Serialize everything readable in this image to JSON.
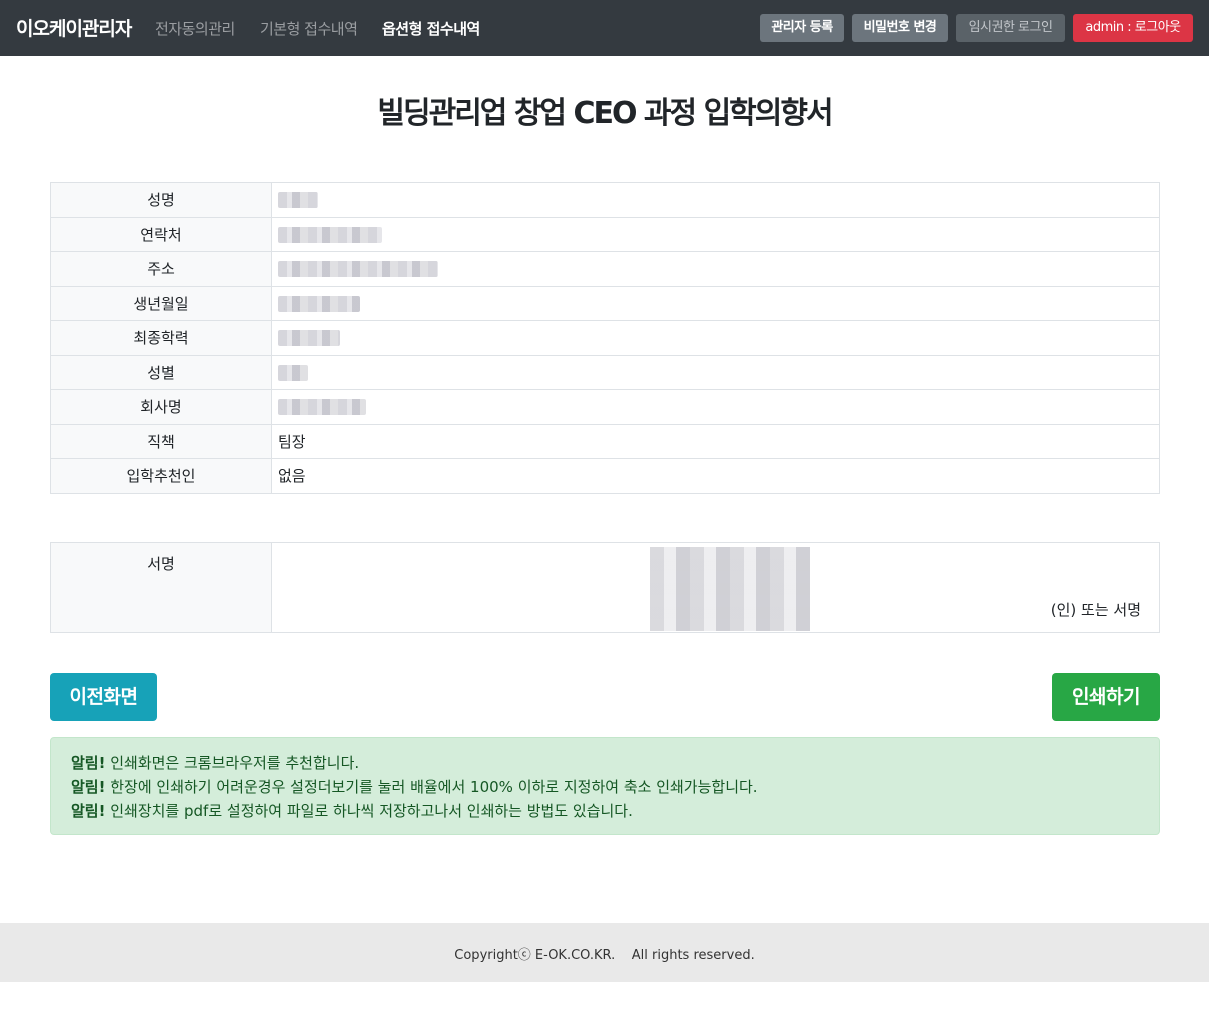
{
  "navbar": {
    "brand": "이오케이관리자",
    "links": [
      "전자동의관리",
      "기본형 접수내역",
      "옵션형 접수내역"
    ],
    "buttons": {
      "register_admin": "관리자 등록",
      "change_password": "비밀번호 변경",
      "temp_login": "임시권한 로그인",
      "logout": "admin : 로그아웃"
    }
  },
  "page": {
    "title": "빌딩관리업 창업 CEO 과정 입학의향서"
  },
  "form": {
    "rows": [
      {
        "label": "성명",
        "value": ""
      },
      {
        "label": "연락처",
        "value": ""
      },
      {
        "label": "주소",
        "value": ""
      },
      {
        "label": "생년월일",
        "value": ""
      },
      {
        "label": "최종학력",
        "value": ""
      },
      {
        "label": "성별",
        "value": ""
      },
      {
        "label": "회사명",
        "value": ""
      },
      {
        "label": "직책",
        "value": "팀장"
      },
      {
        "label": "입학추천인",
        "value": "없음"
      }
    ]
  },
  "signature": {
    "label": "서명",
    "note": "(인) 또는 서명"
  },
  "actions": {
    "prev": "이전화면",
    "print": "인쇄하기"
  },
  "alert": {
    "prefix": "알림!",
    "lines": [
      "인쇄화면은 크롬브라우저를 추천합니다.",
      "한장에 인쇄하기 어려운경우 설정더보기를 눌러 배율에서 100% 이하로 지정하여 축소 인쇄가능합니다.",
      "인쇄장치를 pdf로 설정하여 파일로 하나씩 저장하고나서 인쇄하는 방법도 있습니다."
    ]
  },
  "footer": {
    "text": "Copyrightⓒ E-OK.CO.KR.    All rights reserved."
  }
}
